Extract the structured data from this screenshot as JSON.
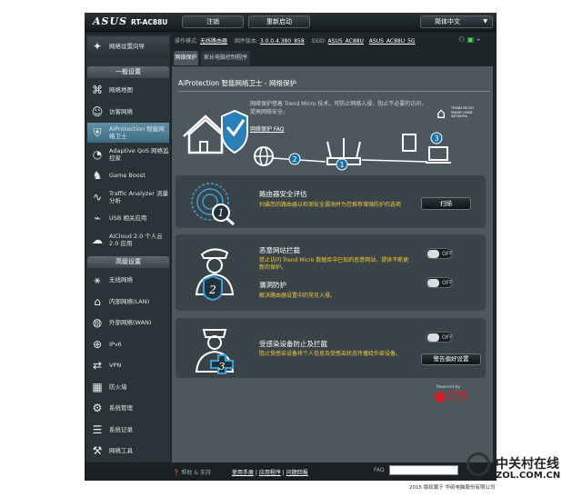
{
  "header": {
    "logo": "ASUS",
    "model": "RT-AC88U",
    "logout": "注销",
    "reboot": "重新启动",
    "language": "简体中文"
  },
  "status": {
    "op_mode_label": "操作模式:",
    "op_mode": "无线路由器",
    "firmware_label": "固件版本:",
    "firmware": "3.0.0.4.380_858",
    "ssid_label": "SSID:",
    "ssid1": "ASUS_AC88U",
    "ssid2": "ASUS_AC88U_5G"
  },
  "sidebar": {
    "quick_setup": "网络设置向导",
    "general_title": "一般设置",
    "general": [
      {
        "icon": "network-map-icon",
        "label": "网络地图"
      },
      {
        "icon": "guest-network-icon",
        "label": "访客网络"
      },
      {
        "icon": "aiprotection-icon",
        "label": "AiProtection 智能网络卫士"
      },
      {
        "icon": "adaptive-qos-icon",
        "label": "Adaptive QoS 网络监控家"
      },
      {
        "icon": "game-boost-icon",
        "label": "Game Boost"
      },
      {
        "icon": "traffic-analyzer-icon",
        "label": "Traffic Analyzer 流量分析"
      },
      {
        "icon": "usb-icon",
        "label": "USB 相关应用"
      },
      {
        "icon": "aicloud-icon",
        "label": "AiCloud 2.0 个人云 2.0 应用"
      }
    ],
    "advanced_title": "高级设置",
    "advanced": [
      {
        "icon": "wireless-icon",
        "label": "无线网络"
      },
      {
        "icon": "lan-icon",
        "label": "内部网络(LAN)"
      },
      {
        "icon": "wan-icon",
        "label": "外部网络(WAN)"
      },
      {
        "icon": "ipv6-icon",
        "label": "IPv6"
      },
      {
        "icon": "vpn-icon",
        "label": "VPN"
      },
      {
        "icon": "firewall-icon",
        "label": "防火墙"
      },
      {
        "icon": "admin-icon",
        "label": "系统管理"
      },
      {
        "icon": "syslog-icon",
        "label": "系统记录"
      },
      {
        "icon": "network-tools-icon",
        "label": "网络工具"
      }
    ]
  },
  "tabs": [
    "网络保护",
    "家长电脑控制程序"
  ],
  "page": {
    "title": "AiProtection 智能网络卫士 - 网络保护",
    "intro": "网络保护借着 Trend Micro 技术，可防止网络入侵，阻止不必要的访问，提高网络安全。",
    "faq": "网络保护 FAQ",
    "trend_badge": "TREND MICRO SMART HOME NETWORK",
    "diagram_steps": [
      "1",
      "2",
      "3"
    ]
  },
  "cards": {
    "router_scan": {
      "title": "路由器安全评估",
      "desc": "扫描您的路由器以检测安全漏洞并为您推荐增强防护的选项",
      "button": "扫描",
      "badge": "1"
    },
    "malicious": {
      "title": "恶意网站拦截",
      "desc": "禁止访问 Trend Micro 数据库中已知的恶意网站，提供不断更新的保护。",
      "toggle": "OFF",
      "vuln_title": "漏洞防护",
      "vuln_desc": "解决路由器设置中的常见入侵。",
      "vuln_toggle": "OFF",
      "badge": "2"
    },
    "infected": {
      "title": "受感染设备防止及拦截",
      "desc": "阻止受感染设备将个人信息及受感染状态传播给外部设备。",
      "toggle": "OFF",
      "button": "警告偏好设置",
      "badge": "3"
    },
    "powered_by": "Powered by",
    "trend": "TREND MICRO"
  },
  "footer": {
    "help": "帮助 & 支持",
    "manual": "使用手册",
    "utility": "应用程序",
    "feedback": "问题回报",
    "faq_label": "FAQ",
    "copyright": "2015 版权属于 华硕电脑股份有限公司"
  },
  "watermark": {
    "brand": "中关村在线",
    "site": "ZOL.COM.CN"
  }
}
